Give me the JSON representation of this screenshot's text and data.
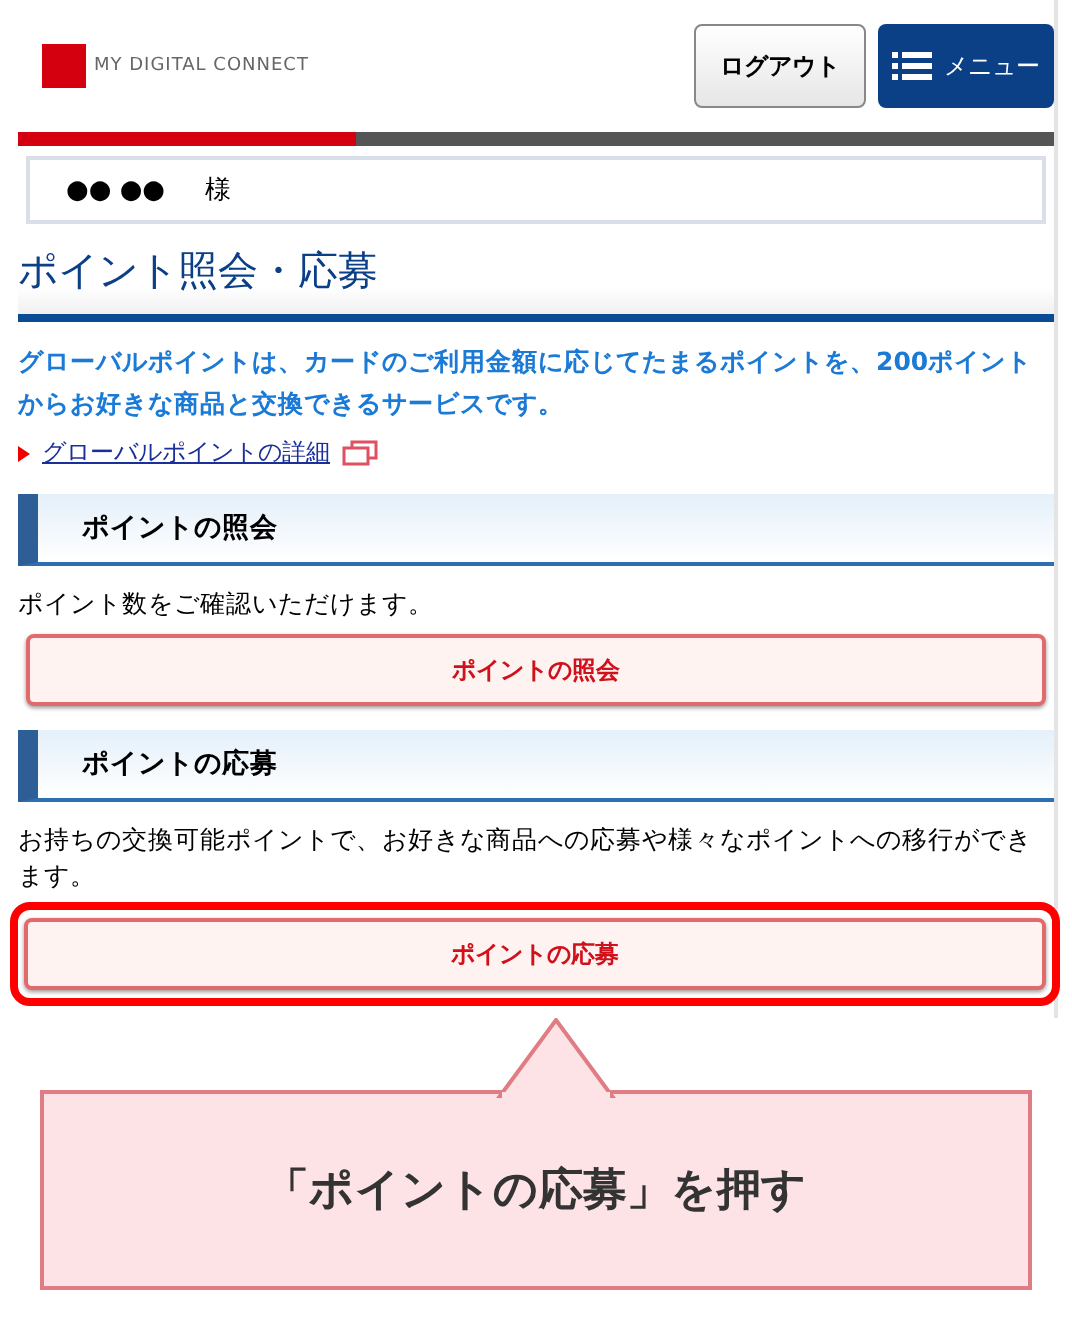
{
  "header": {
    "logo_text": "MY DIGITAL CONNECT",
    "logout_button": "ログアウト",
    "menu_button": "メニュー"
  },
  "user": {
    "name": "●● ●●",
    "honorific": "様"
  },
  "page_title": "ポイント照会・応募",
  "intro": "グローバルポイントは、カードのご利用金額に応じてたまるポイントを、200ポイントからお好きな商品と交換できるサービスです。",
  "detail_link": "グローバルポイントの詳細",
  "sections": [
    {
      "heading": "ポイントの照会",
      "description": "ポイント数をご確認いただけます。",
      "button": "ポイントの照会",
      "highlighted": false
    },
    {
      "heading": "ポイントの応募",
      "description": "お持ちの交換可能ポイントで、お好きな商品への応募や様々なポイントへの移行ができます。",
      "button": "ポイントの応募",
      "highlighted": true
    }
  ],
  "callout": "「ポイントの応募」を押す"
}
